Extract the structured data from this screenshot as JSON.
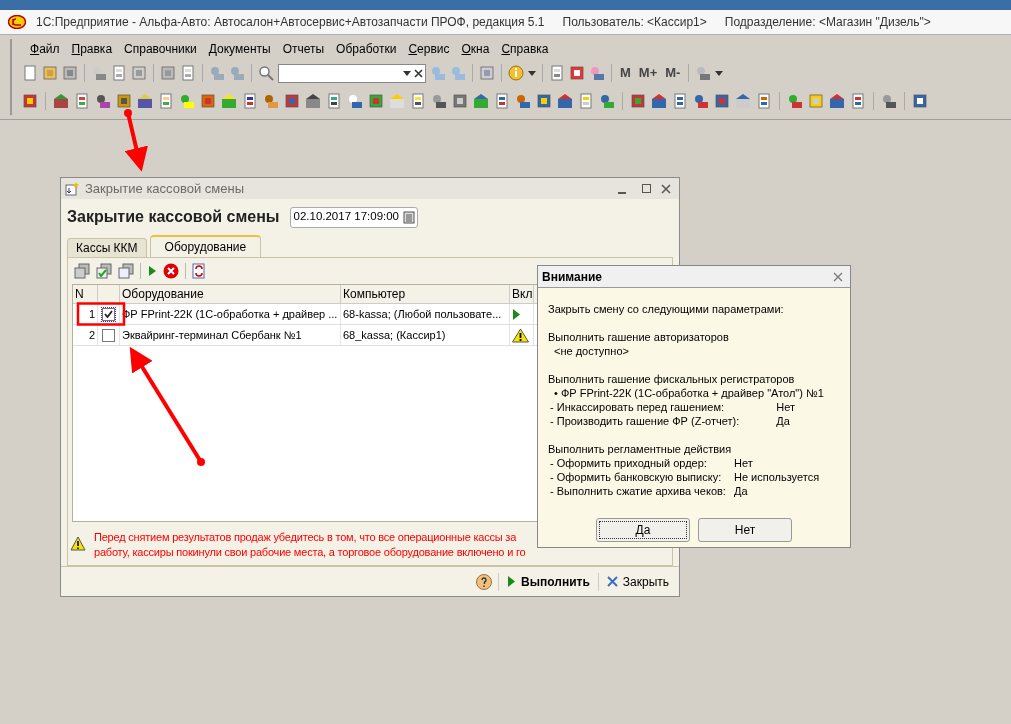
{
  "app_title": {
    "text": "1С:Предприятие - Альфа-Авто: Автосалон+Автосервис+Автозапчасти ПРОФ, редакция 5.1",
    "user": "Пользователь: <Кассир1>",
    "department": "Подразделение: <Магазин \"Дизель\">"
  },
  "menu": [
    {
      "label": "Файл",
      "underline_first": true
    },
    {
      "label": "Правка",
      "underline_first": true
    },
    {
      "label": "Справочники",
      "underline_first": false
    },
    {
      "label": "Документы",
      "underline_first": false
    },
    {
      "label": "Отчеты",
      "underline_first": false
    },
    {
      "label": "Обработки",
      "underline_first": false
    },
    {
      "label": "Сервис",
      "underline_first": true
    },
    {
      "label": "Окна",
      "underline_first": true
    },
    {
      "label": "Справка",
      "underline_first": true
    }
  ],
  "toolbar": {
    "memory_buttons": [
      "M",
      "M+",
      "M-"
    ]
  },
  "form": {
    "window_title": "Закрытие кассовой смены",
    "active": false,
    "heading": "Закрытие кассовой смены",
    "date": "02.10.2017 17:09:00",
    "tabs": [
      {
        "label": "Кассы ККМ",
        "selected": false
      },
      {
        "label": "Оборудование",
        "selected": true
      }
    ],
    "table": {
      "columns": {
        "number": "N",
        "equipment": "Оборудование",
        "computer": "Компьютер",
        "enabled": "Вкл"
      },
      "rows": [
        {
          "n": "1",
          "checked": true,
          "equipment": "ФР FPrint-22К (1С-обработка + драйвер ...",
          "computer": "68-kassa; (Любой пользовате...",
          "kind": "play"
        },
        {
          "n": "2",
          "checked": false,
          "equipment": "Эквайринг-терминал Сбербанк №1",
          "computer": "68_kassa; (Кассир1)",
          "kind": "warning"
        }
      ]
    },
    "warning_lines": [
      "Перед снятием результатов продаж убедитесь в том, что все операционные кассы за",
      "работу, кассиры покинули свои рабочие места, а торговое оборудование включено и го"
    ],
    "footer": {
      "run": "Выполнить",
      "close": "Закрыть"
    }
  },
  "dialog": {
    "title": "Внимание",
    "intro": "Закрыть смену со следующими параметрами:",
    "sections": [
      {
        "heading": "Выполнить гашение авторизаторов",
        "lines": [
          {
            "kind": "plain",
            "text": "<не доступно>"
          }
        ]
      },
      {
        "heading": "Выполнить гашение фискальных регистраторов",
        "lines": [
          {
            "kind": "bullet",
            "bullet": "•",
            "text": "ФР FPrint-22К (1С-обработка + драйвер \"Атол\") №1"
          },
          {
            "kind": "pair",
            "bullet": "-",
            "text": "Инкассировать перед гашением:",
            "value": "Нет"
          },
          {
            "kind": "pair",
            "bullet": "-",
            "text": "Производить гашение ФР (Z-отчет):",
            "value": "Да"
          }
        ]
      },
      {
        "heading": "Выполнить регламентные действия",
        "lines": [
          {
            "kind": "pair",
            "bullet": "-",
            "text": "Оформить приходный ордер:",
            "value": "Нет"
          },
          {
            "kind": "pair",
            "bullet": "-",
            "text": "Оформить банковскую выписку:",
            "value": "Не используется"
          },
          {
            "kind": "pair",
            "bullet": "-",
            "text": "Выполнить сжатие архива чеков:",
            "value": "Да"
          }
        ]
      }
    ],
    "buttons": [
      {
        "label": "Да",
        "selected": true
      },
      {
        "label": "Нет",
        "selected": false
      }
    ]
  }
}
